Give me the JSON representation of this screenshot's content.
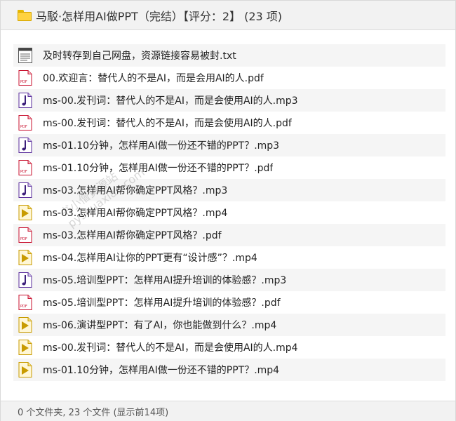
{
  "header": {
    "title": "马駁·怎样用AI做PPT（完结）【评分：2】 (23 项)",
    "folder_icon": "folder-icon"
  },
  "files": [
    {
      "name": "及时转存到自己网盘，资源链接容易被封.txt",
      "icon": "txt-file-icon"
    },
    {
      "name": "00.欢迎言：替代人的不是AI，而是会用AI的人.pdf",
      "icon": "pdf-file-icon"
    },
    {
      "name": "ms-00.发刊词：替代人的不是AI，而是会使用AI的人.mp3",
      "icon": "mp3-file-icon"
    },
    {
      "name": "ms-00.发刊词：替代人的不是AI，而是会使用AI的人.pdf",
      "icon": "pdf-file-icon"
    },
    {
      "name": "ms-01.10分钟，怎样用AI做一份还不错的PPT？.mp3",
      "icon": "mp3-file-icon"
    },
    {
      "name": "ms-01.10分钟，怎样用AI做一份还不错的PPT？.pdf",
      "icon": "pdf-file-icon"
    },
    {
      "name": "ms-03.怎样用AI帮你确定PPT风格？.mp3",
      "icon": "mp3-file-icon"
    },
    {
      "name": "ms-03.怎样用AI帮你确定PPT风格？.mp4",
      "icon": "mp4-file-icon"
    },
    {
      "name": "ms-03.怎样用AI帮你确定PPT风格？.pdf",
      "icon": "pdf-file-icon"
    },
    {
      "name": "ms-04.怎样用AI让你的PPT更有“设计感”？.mp4",
      "icon": "mp4-file-icon"
    },
    {
      "name": "ms-05.培训型PPT：怎样用AI提升培训的体验感？.mp3",
      "icon": "mp3-file-icon"
    },
    {
      "name": "ms-05.培训型PPT：怎样用AI提升培训的体验感？.pdf",
      "icon": "pdf-file-icon"
    },
    {
      "name": "ms-06.演讲型PPT：有了AI，你也能做到什么？.mp4",
      "icon": "mp4-file-icon"
    },
    {
      "name": "ms-00.发刊词：替代人的不是AI，而是会使用AI的人.mp4",
      "icon": "mp4-file-icon"
    },
    {
      "name": "ms-01.10分钟，怎样用AI做一份还不错的PPT？.mp4",
      "icon": "mp4-file-icon"
    }
  ],
  "footer": {
    "status": "0 个文件夹, 23 个文件 (显示前14项)"
  },
  "watermark": {
    "line1": "书小僧资源站",
    "line2": "pyshuaxiao.com"
  },
  "colors": {
    "pdf_red": "#c8102e",
    "mp3_purple": "#5a2d9c",
    "mp4_gold": "#c89b00",
    "folder_yellow": "#ffd23f"
  }
}
